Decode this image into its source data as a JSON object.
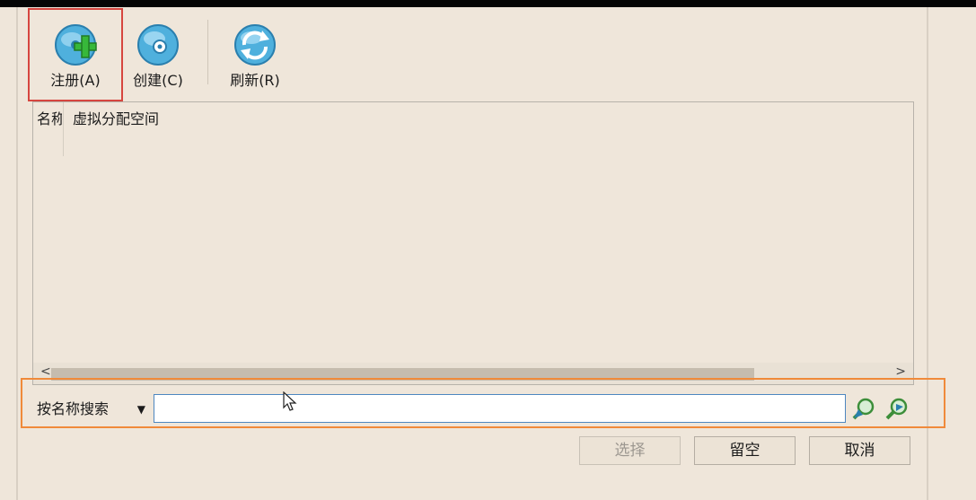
{
  "toolbar": {
    "register_label": "注册(A)",
    "create_label": "创建(C)",
    "refresh_label": "刷新(R)"
  },
  "list": {
    "columns": [
      "名称",
      "虚拟分配空间"
    ],
    "scroll_left": "<",
    "scroll_right": ">"
  },
  "search": {
    "mode": "按名称搜索",
    "value": "",
    "placeholder": ""
  },
  "buttons": {
    "choose": "选择",
    "leave_empty": "留空",
    "cancel": "取消"
  },
  "colors": {
    "highlight_register": "#d6463f",
    "highlight_search": "#f08a3a",
    "input_border": "#4e87c0"
  },
  "icons": {
    "register": "add-disk-icon",
    "create": "create-disk-icon",
    "refresh": "refresh-icon",
    "search_prev": "search-previous-icon",
    "search_next": "search-next-icon"
  }
}
